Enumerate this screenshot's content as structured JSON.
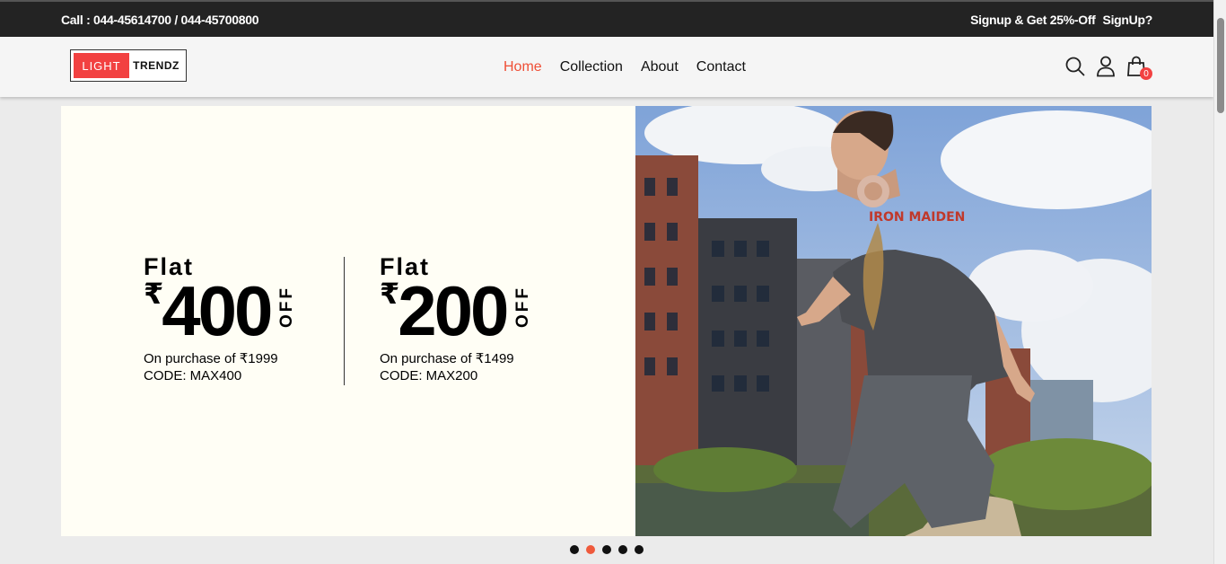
{
  "topbar": {
    "call": "Call : 044-45614700 / 044-45700800",
    "promo": "Signup & Get 25%-Off",
    "signup": "SignUp?"
  },
  "brand": {
    "part1": "LIGHT",
    "part2": "TRENDZ"
  },
  "nav": {
    "home": "Home",
    "collection": "Collection",
    "about": "About",
    "contact": "Contact"
  },
  "icons": {
    "search": "search-icon",
    "user": "user-icon",
    "cart": "shopping-bag-icon"
  },
  "cart": {
    "count": "0"
  },
  "banner": {
    "offers": [
      {
        "flat": "Flat",
        "rupee": "₹",
        "amount": "400",
        "off": "OFF",
        "purchase": "On purchase of ₹1999",
        "code": "CODE: MAX400"
      },
      {
        "flat": "Flat",
        "rupee": "₹",
        "amount": "200",
        "off": "OFF",
        "purchase": "On purchase of ₹1499",
        "code": "CODE: MAX200"
      }
    ]
  },
  "carousel": {
    "count": 5,
    "active_index": 1
  },
  "colors": {
    "accent": "#ef4f36",
    "topbar": "#232323",
    "banner_bg": "#fffef5"
  }
}
